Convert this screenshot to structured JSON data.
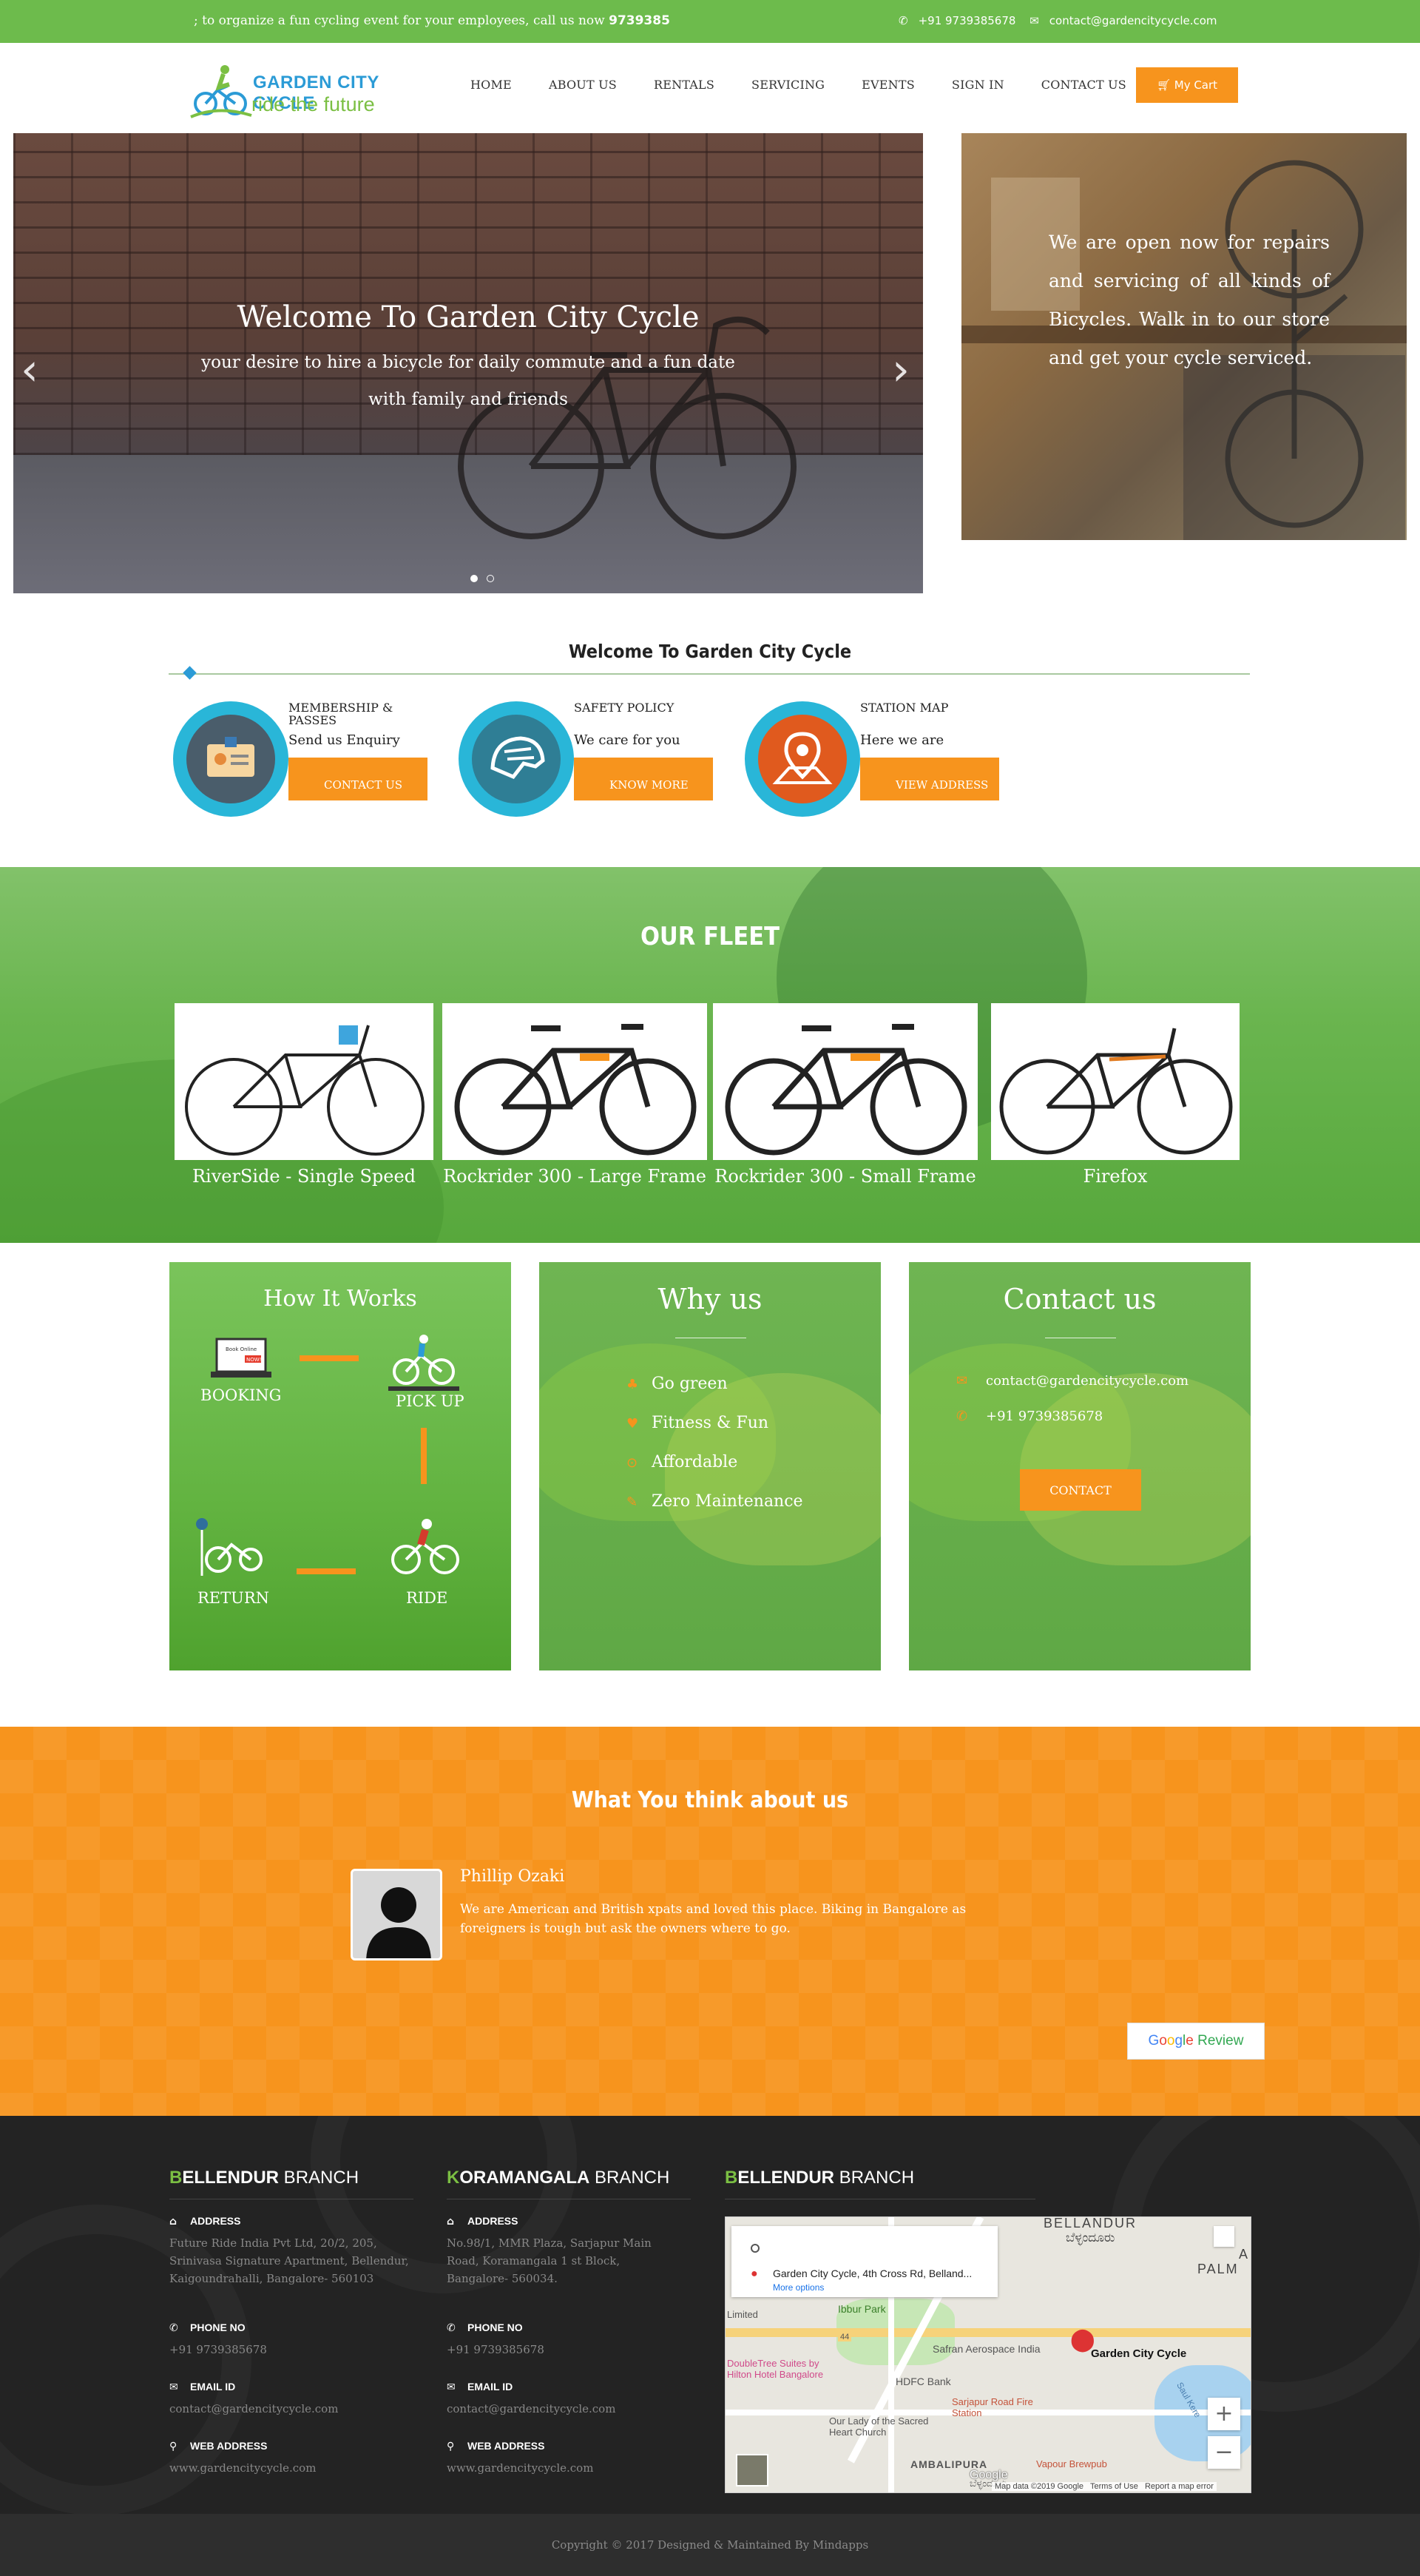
{
  "topbar": {
    "marquee_text": "; to organize a fun cycling event for your employees, call us now ",
    "marquee_phone": "9739385",
    "phone": "+91 9739385678",
    "email": "contact@gardencitycycle.com"
  },
  "brand": {
    "name": "GARDEN CITY CYCLE",
    "tagline": "ride the future"
  },
  "nav": [
    "HOME",
    "ABOUT US",
    "RENTALS",
    "SERVICING",
    "EVENTS",
    "SIGN IN",
    "CONTACT US"
  ],
  "cart_label": "My Cart",
  "hero": {
    "title": "Welcome To Garden City Cycle",
    "subtitle": "your desire to hire a bicycle for daily commute and a fun date with family and friends",
    "slides_total": 2,
    "active_slide": 1
  },
  "workshop_text": "We are open now for repairs and servicing of all kinds of Bicycles. Walk in to our store and get your cycle serviced.",
  "welcome": {
    "title": "Welcome To Garden City Cycle",
    "features": [
      {
        "label": "MEMBERSHIP & PASSES",
        "desc": "Send us Enquiry",
        "button": "CONTACT US",
        "icon": "membership-card-icon"
      },
      {
        "label": "SAFETY POLICY",
        "desc": "We care for you",
        "button": "KNOW MORE",
        "icon": "helmet-icon"
      },
      {
        "label": "STATION MAP",
        "desc": "Here we are",
        "button": "VIEW ADDRESS",
        "icon": "map-pin-icon"
      }
    ]
  },
  "fleet": {
    "title": "OUR FLEET",
    "bikes": [
      "RiverSide - Single Speed",
      "Rockrider 300 - Large Frame",
      "Rockrider 300 - Small Frame",
      "Firefox"
    ]
  },
  "how_it_works": {
    "title": "How It Works",
    "steps": [
      "BOOKING",
      "PICK UP",
      "RIDE",
      "RETURN"
    ],
    "laptop_text": "Book Online",
    "laptop_badge": "NOW!"
  },
  "why_us": {
    "title": "Why us",
    "items": [
      "Go green",
      "Fitness & Fun",
      "Affordable",
      "Zero Maintenance"
    ]
  },
  "contact_panel": {
    "title": "Contact us",
    "email": "contact@gardencitycycle.com",
    "phone": "+91 9739385678",
    "button": "CONTACT"
  },
  "testimonials": {
    "title": "What You think about us",
    "name": "Phillip Ozaki",
    "text": "We are American and British xpats and loved this place. Biking in Bangalore as foreigners is tough but ask the owners where to go.",
    "review_button": [
      "G",
      "o",
      "o",
      "g",
      "l",
      "e"
    ],
    "review_word": "Review"
  },
  "footer": {
    "branch1": {
      "title_first": "B",
      "title_rest": "ELLENDUR",
      "title_suffix": " BRANCH",
      "address_label": "ADDRESS",
      "address": "Future Ride India Pvt Ltd, 20/2, 205, Srinivasa Signature Apartment, Bellendur, Kaigoundrahalli, Bangalore- 560103",
      "phone_label": "PHONE NO",
      "phone": "+91 9739385678",
      "email_label": "EMAIL ID",
      "email": "contact@gardencitycycle.com",
      "web_label": "WEB ADDRESS",
      "web": "www.gardencitycycle.com"
    },
    "branch2": {
      "title_first": "K",
      "title_rest": "ORAMANGALA",
      "title_suffix": " BRANCH",
      "address_label": "ADDRESS",
      "address": "No.98/1, MMR Plaza, Sarjapur Main Road, Koramangala 1 st Block, Bangalore- 560034.",
      "phone_label": "PHONE NO",
      "phone": "+91 9739385678",
      "email_label": "EMAIL ID",
      "email": "contact@gardencitycycle.com",
      "web_label": "WEB ADDRESS",
      "web": "www.gardencitycycle.com"
    },
    "branch3": {
      "title_first": "B",
      "title_rest": "ELLENDUR",
      "title_suffix": " BRANCH"
    },
    "map": {
      "place": "Garden City Cycle, 4th Cross Rd, Belland...",
      "more": "More options",
      "pin_label": "Garden City Cycle",
      "labels": [
        "BELLANDUR",
        "ಬೆಳ್ಳಂದೂರು",
        "Ibbur Park",
        "Safran Aerospace India",
        "DoubleTree Suites by Hilton Hotel Bangalore",
        "HDFC Bank",
        "Sarjapur Road Fire Station",
        "Our Lady of the Sacred Heart Church",
        "AMBALIPURA",
        "Vapour Brewpub",
        "Limited",
        "PALM",
        "A",
        "Saul Kere",
        "ಬೆಳ್ಳಂದೂರು"
      ],
      "attribution": [
        "Map data ©2019 Google",
        "Terms of Use",
        "Report a map error"
      ],
      "google": "Google",
      "road_number": "44"
    }
  },
  "copyright": "Copyright © 2017 Designed & Maintained By Mindapps"
}
